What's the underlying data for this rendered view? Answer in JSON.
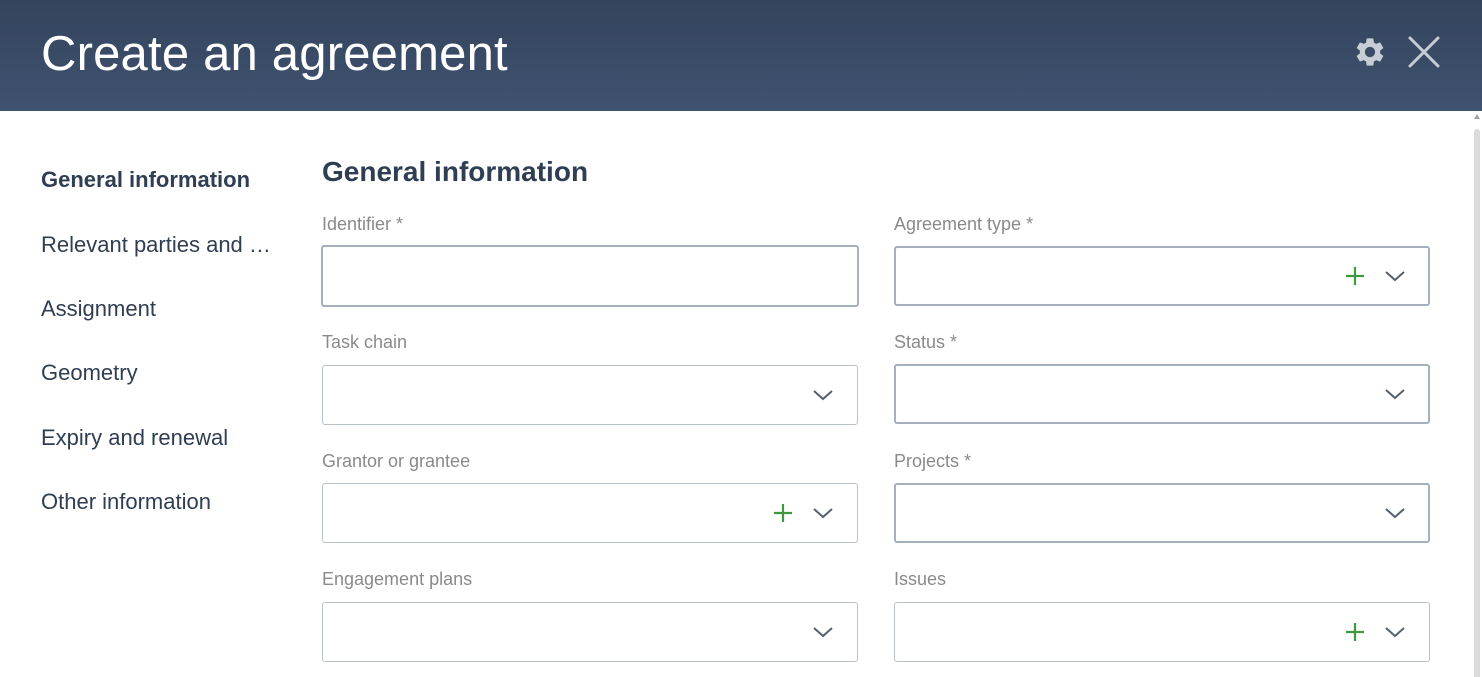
{
  "header": {
    "title": "Create an agreement",
    "settings_icon": "gear-icon",
    "close_icon": "close-icon"
  },
  "sidenav": {
    "items": [
      {
        "label": "General information",
        "active": true
      },
      {
        "label": "Relevant parties and …",
        "active": false
      },
      {
        "label": "Assignment",
        "active": false
      },
      {
        "label": "Geometry",
        "active": false
      },
      {
        "label": "Expiry and renewal",
        "active": false
      },
      {
        "label": "Other information",
        "active": false
      }
    ]
  },
  "form": {
    "section_title": "General information",
    "fields": {
      "identifier": {
        "label": "Identifier *",
        "value": ""
      },
      "agreement_type": {
        "label": "Agreement type *",
        "value": ""
      },
      "task_chain": {
        "label": "Task chain",
        "value": ""
      },
      "status": {
        "label": "Status *",
        "value": ""
      },
      "grantor_grantee": {
        "label": "Grantor or grantee",
        "value": ""
      },
      "projects": {
        "label": "Projects *",
        "value": ""
      },
      "engagement_plans": {
        "label": "Engagement plans",
        "value": ""
      },
      "issues": {
        "label": "Issues",
        "value": ""
      }
    }
  },
  "colors": {
    "header_bg": "#3a4b64",
    "text_primary": "#2f3e52",
    "label_gray": "#8a8a8a",
    "add_green": "#3f9a3f"
  }
}
